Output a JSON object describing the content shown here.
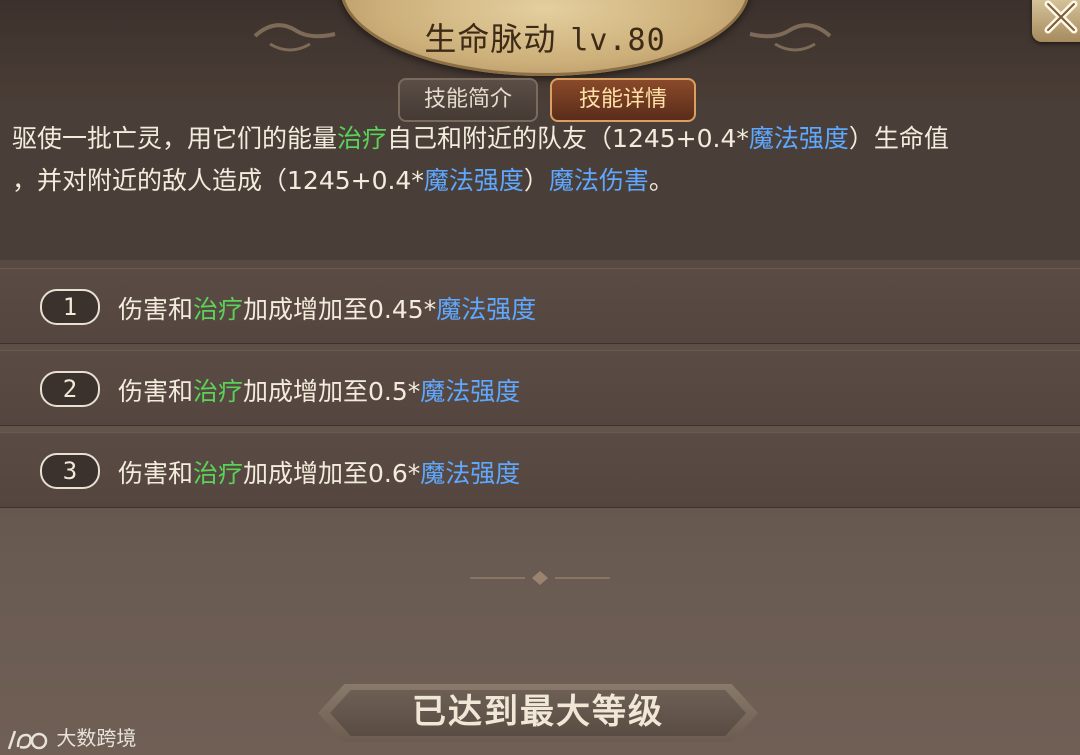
{
  "header": {
    "skill_name": "生命脉动",
    "level": "lv.80"
  },
  "tabs": [
    {
      "label": "技能简介",
      "active": false
    },
    {
      "label": "技能详情",
      "active": true
    }
  ],
  "description": {
    "line1": [
      {
        "text": "驱使一批亡灵，用它们的能量",
        "color": "normal"
      },
      {
        "text": "治疗",
        "color": "green"
      },
      {
        "text": "自己和附近的队友（1245+0.4*",
        "color": "normal"
      },
      {
        "text": "魔法强度",
        "color": "blue"
      },
      {
        "text": "）生命值",
        "color": "normal"
      }
    ],
    "line2": [
      {
        "text": "，并对附近的敌人造成（1245+0.4*",
        "color": "normal"
      },
      {
        "text": "魔法强度",
        "color": "blue"
      },
      {
        "text": "）",
        "color": "normal"
      },
      {
        "text": "魔法伤害",
        "color": "blue"
      },
      {
        "text": "。",
        "color": "normal"
      }
    ]
  },
  "upgrades": [
    {
      "index": "1",
      "prefix": "伤害和",
      "green": "治疗",
      "middle": "加成增加至0.45*",
      "blue": "魔法强度"
    },
    {
      "index": "2",
      "prefix": "伤害和",
      "green": "治疗",
      "middle": "加成增加至0.5*",
      "blue": "魔法强度"
    },
    {
      "index": "3",
      "prefix": "伤害和",
      "green": "治疗",
      "middle": "加成增加至0.6*",
      "blue": "魔法强度"
    }
  ],
  "footer": {
    "max_level_label": "已达到最大等级"
  },
  "watermark": {
    "text": "大数跨境"
  },
  "colors": {
    "accent_green": "#5ad25a",
    "accent_blue": "#5ea8ff",
    "tab_active": "#8a4a2a"
  }
}
